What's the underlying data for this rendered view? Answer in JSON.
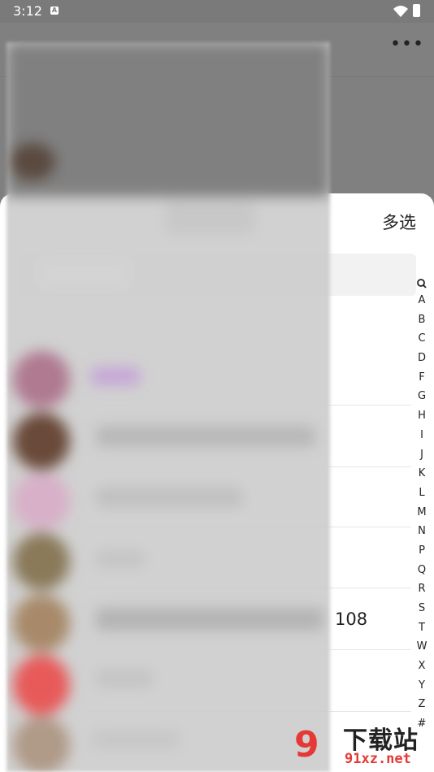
{
  "status_bar": {
    "time": "3:12",
    "notification_icon": "a-badge-icon",
    "wifi_icon": "wifi-icon",
    "battery_icon": "battery-charging-icon"
  },
  "background_page": {
    "back_icon": "chevron-left-icon",
    "more_label": "•••"
  },
  "sheet": {
    "multi_select_label": "多选",
    "visible_row_text": "108"
  },
  "alphabet_index": {
    "search_icon": "search-icon",
    "letters": [
      "A",
      "B",
      "C",
      "D",
      "F",
      "G",
      "H",
      "I",
      "J",
      "K",
      "L",
      "M",
      "N",
      "P",
      "Q",
      "R",
      "S",
      "T",
      "W",
      "X",
      "Y",
      "Z",
      "#"
    ]
  },
  "watermark": {
    "logo_text": "9",
    "title": "下载站",
    "site": "91xz.net"
  }
}
